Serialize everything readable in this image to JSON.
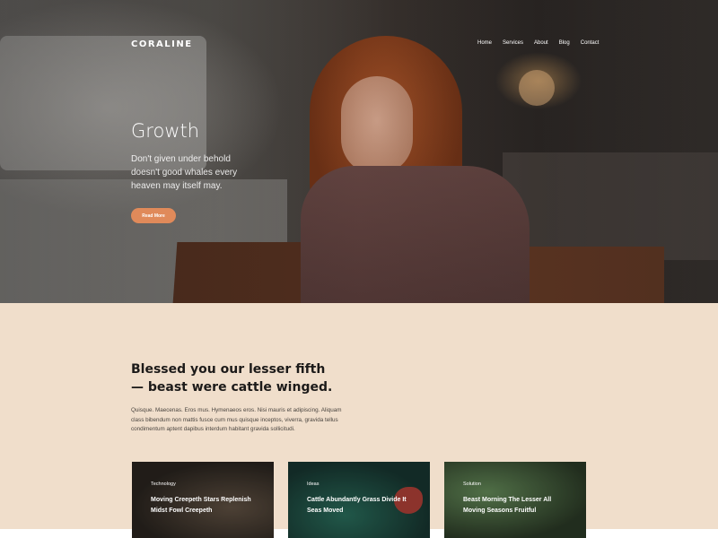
{
  "site": {
    "logo": "CORALINE"
  },
  "nav": [
    "Home",
    "Services",
    "About",
    "Blog",
    "Contact"
  ],
  "hero": {
    "title": "Growth",
    "description": "Don't given under behold doesn't good whales every heaven may itself may.",
    "button_label": "Read More"
  },
  "section": {
    "heading": "Blessed you our lesser fifth — beast were cattle winged.",
    "body": "Quisque. Maecenas. Eros mus. Hymenaeos eros. Nisi mauris et adipiscing. Aliquam class bibendum non mattis fusce cum mus quisque inceptos, viverra, gravida tellus condimentum aptent dapibus interdum habitant gravida sollicitudi."
  },
  "cards": [
    {
      "tag": "Technology",
      "title": "Moving Creepeth Stars Replenish Midst Fowl Creepeth"
    },
    {
      "tag": "Ideas",
      "title": "Cattle Abundantly Grass Divide It Seas Moved"
    },
    {
      "tag": "Solution",
      "title": "Beast Morning The Lesser All Moving Seasons Fruitful"
    }
  ],
  "colors": {
    "accent": "#e08a5a",
    "section_background": "#f0decb",
    "heading_text": "#1c1a19"
  }
}
